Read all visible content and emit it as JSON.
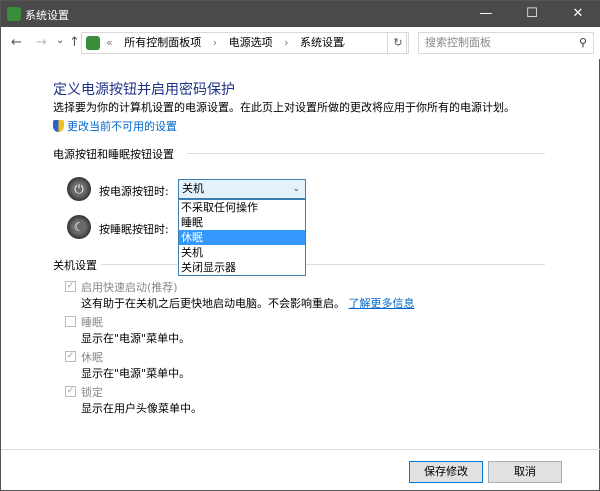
{
  "window": {
    "title": "系统设置",
    "minimize": "—",
    "maximize": "☐",
    "close": "✕"
  },
  "nav": {
    "back": "←",
    "forward": "→",
    "recent": "⌄",
    "up": "↑",
    "crumbs_prefix": "«",
    "crumbs": [
      "所有控制面板项",
      "电源选项",
      "系统设置"
    ],
    "crumb_sep": "›",
    "dropdown": "⌄",
    "refresh": "↻",
    "search_placeholder": "搜索控制面板",
    "search_icon": "⚲"
  },
  "main": {
    "title": "定义电源按钮并启用密码保护",
    "description": "选择要为你的计算机设置的电源设置。在此页上对设置所做的更改将应用于你所有的电源计划。",
    "change_link": "更改当前不可用的设置",
    "power_group": "电源按钮和睡眠按钮设置",
    "power_button_label": "按电源按钮时:",
    "power_button_value": "关机",
    "sleep_button_label": "按睡眠按钮时:",
    "options": [
      "不采取任何操作",
      "睡眠",
      "休眠",
      "关机",
      "关闭显示器"
    ],
    "shutdown_group": "关机设置",
    "settings": [
      {
        "label": "启用快速启动(推荐)",
        "checked": true,
        "desc": "这有助于在关机之后更快地启动电脑。不会影响重启。",
        "link": "了解更多信息"
      },
      {
        "label": "睡眠",
        "checked": false,
        "desc": "显示在\"电源\"菜单中。"
      },
      {
        "label": "休眠",
        "checked": true,
        "desc": "显示在\"电源\"菜单中。"
      },
      {
        "label": "锁定",
        "checked": true,
        "desc": "显示在用户头像菜单中。"
      }
    ]
  },
  "footer": {
    "save": "保存修改",
    "cancel": "取消"
  }
}
